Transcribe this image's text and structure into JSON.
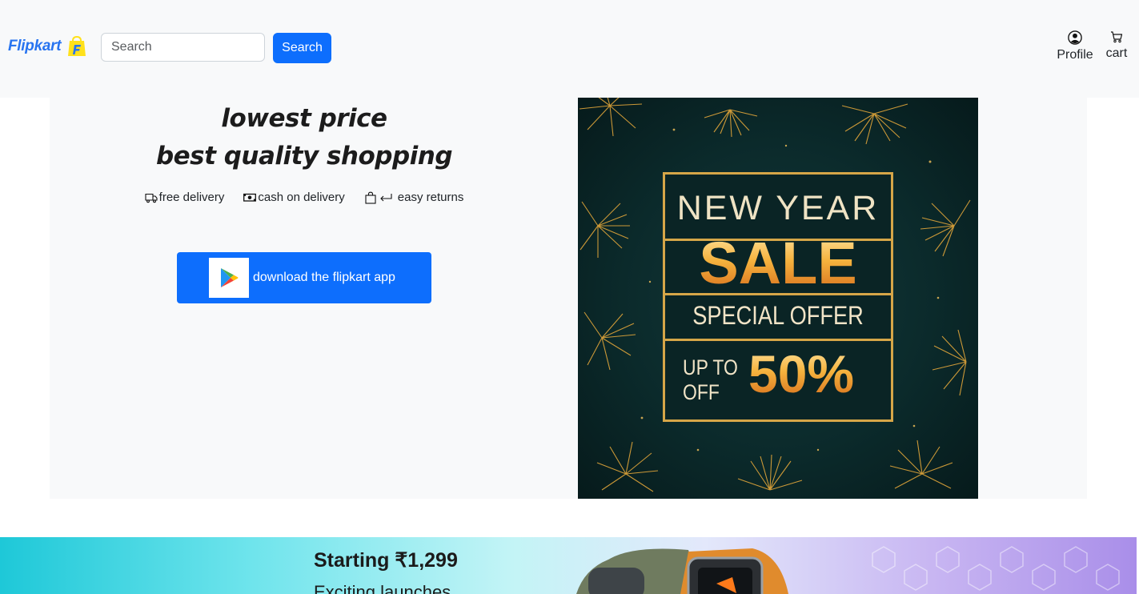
{
  "header": {
    "brand": "Flipkart",
    "search_placeholder": "Search",
    "search_button": "Search",
    "profile_label": "Profile",
    "cart_label": "cart"
  },
  "hero": {
    "headline_1": "lowest price",
    "headline_2": "best quality shopping",
    "features": [
      {
        "label": "free delivery",
        "icon": "truck-icon"
      },
      {
        "label": "cash on delivery",
        "icon": "cash-icon"
      },
      {
        "label": "easy returns",
        "icon": "bag-return-icon"
      }
    ],
    "app_button": "download the flipkart app"
  },
  "sale_banner": {
    "line_1": "NEW YEAR",
    "line_2": "SALE",
    "line_3": "SPECIAL OFFER",
    "upto_1": "UP TO",
    "upto_2": "OFF",
    "discount": "50%"
  },
  "promo": {
    "price": "Starting ₹1,299",
    "subtitle": "Exciting launches"
  },
  "colors": {
    "primary": "#0d6efd",
    "navbar_bg": "#f8f9fa",
    "brand_blue": "#2874f0",
    "brand_yellow": "#ffe11b",
    "gold": "#d6a648"
  }
}
